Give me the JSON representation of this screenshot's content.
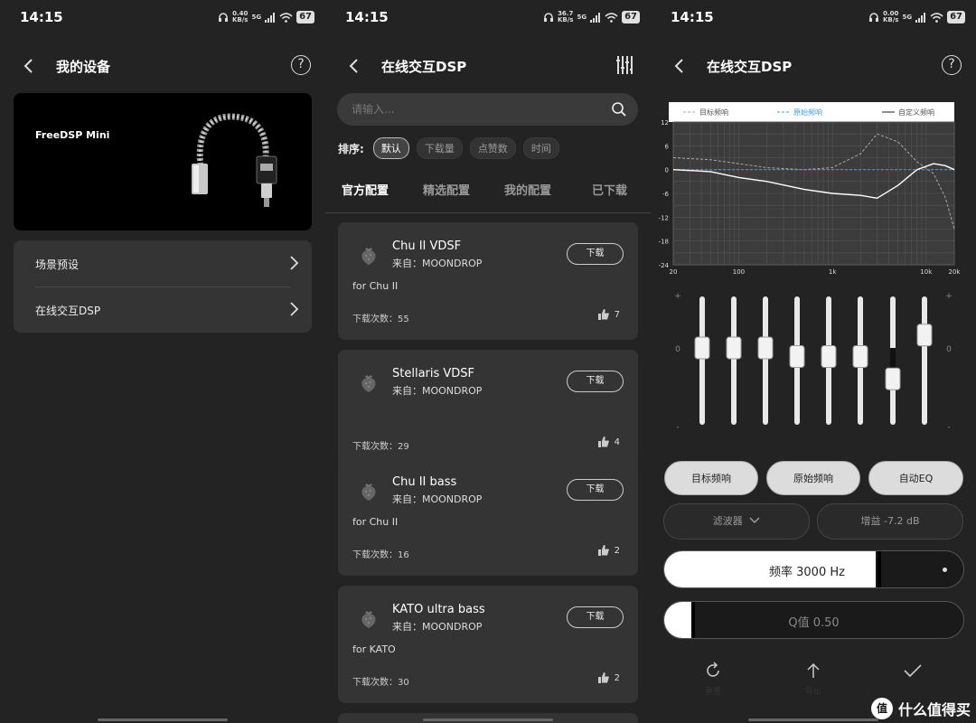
{
  "status_time": "14:15",
  "screen1": {
    "net": [
      "0.40",
      "KB/s"
    ],
    "battery": "67",
    "title": "我的设备",
    "device_name": "FreeDSP Mini",
    "menu": [
      {
        "label": "场景预设"
      },
      {
        "label": "在线交互DSP"
      }
    ]
  },
  "screen2": {
    "net": [
      "36.7",
      "KB/s"
    ],
    "battery": "67",
    "title": "在线交互DSP",
    "search_placeholder": "请输入...",
    "sort_label": "排序:",
    "sort_options": [
      "默认",
      "下载量",
      "点赞数",
      "时间"
    ],
    "tabs": [
      "官方配置",
      "精选配置",
      "我的配置",
      "已下载"
    ],
    "download_label": "下载",
    "configs": [
      {
        "name": "Chu II VDSF",
        "from": "来自：MOONDROP",
        "for": "for Chu II",
        "downloads": "下载次数：55",
        "likes": "7"
      },
      {
        "name": "Stellaris VDSF",
        "from": "来自：MOONDROP",
        "for": "",
        "downloads": "下载次数：29",
        "likes": "4"
      },
      {
        "name": "Chu II bass",
        "from": "来自：MOONDROP",
        "for": "for Chu II",
        "downloads": "下载次数：16",
        "likes": "2"
      },
      {
        "name": "KATO ultra bass",
        "from": "来自：MOONDROP",
        "for": "for KATO",
        "downloads": "下载次数：30",
        "likes": "2"
      }
    ]
  },
  "screen3": {
    "net": [
      "0.00",
      "KB/s"
    ],
    "battery": "67",
    "title": "在线交互DSP",
    "legend": [
      "目标频响",
      "原始频响",
      "自定义频响"
    ],
    "y_ticks": [
      "12",
      "6",
      "0",
      "-6",
      "-12",
      "-18",
      "-24"
    ],
    "x_ticks": [
      "20",
      "100",
      "1k",
      "10k",
      "20k"
    ],
    "slider_scale": [
      "+",
      "0",
      "-"
    ],
    "buttons": [
      "目标频响",
      "原始频响",
      "自动EQ"
    ],
    "filter_label": "滤波器",
    "gain_label": "增益 -7.2 dB",
    "freq_label": "频率 3000 Hz",
    "q_label": "Q值 0.50",
    "actions": [
      "重置",
      "导出",
      ""
    ],
    "watermark": "什么值得买",
    "watermark_logo": "值"
  },
  "chart_data": {
    "type": "line",
    "x_scale": "log",
    "xlim": [
      20,
      20000
    ],
    "ylim": [
      -24,
      12
    ],
    "xlabel": "",
    "ylabel": "",
    "series": [
      {
        "name": "目标频响",
        "style": "dashed",
        "color": "#aaaaaa",
        "x": [
          20,
          50,
          100,
          200,
          500,
          1000,
          2000,
          3000,
          5000,
          8000,
          12000,
          16000,
          20000
        ],
        "y": [
          3,
          2.5,
          1.5,
          0.5,
          0,
          0.5,
          4,
          9,
          7,
          2,
          -1,
          -7,
          -15
        ]
      },
      {
        "name": "原始频响",
        "style": "dashed",
        "color": "#4a9fd5",
        "x": [
          20,
          20000
        ],
        "y": [
          0,
          0
        ]
      },
      {
        "name": "自定义频响",
        "style": "solid",
        "color": "#ffffff",
        "x": [
          20,
          50,
          100,
          200,
          500,
          1000,
          2000,
          3000,
          5000,
          8000,
          12000,
          16000,
          20000
        ],
        "y": [
          0,
          -0.5,
          -2,
          -3,
          -5,
          -6,
          -6.5,
          -7.2,
          -4,
          0,
          1.5,
          1,
          0
        ]
      }
    ]
  },
  "eq_bands": [
    0,
    0,
    0,
    -2,
    -2,
    -2,
    -7.2,
    3
  ]
}
